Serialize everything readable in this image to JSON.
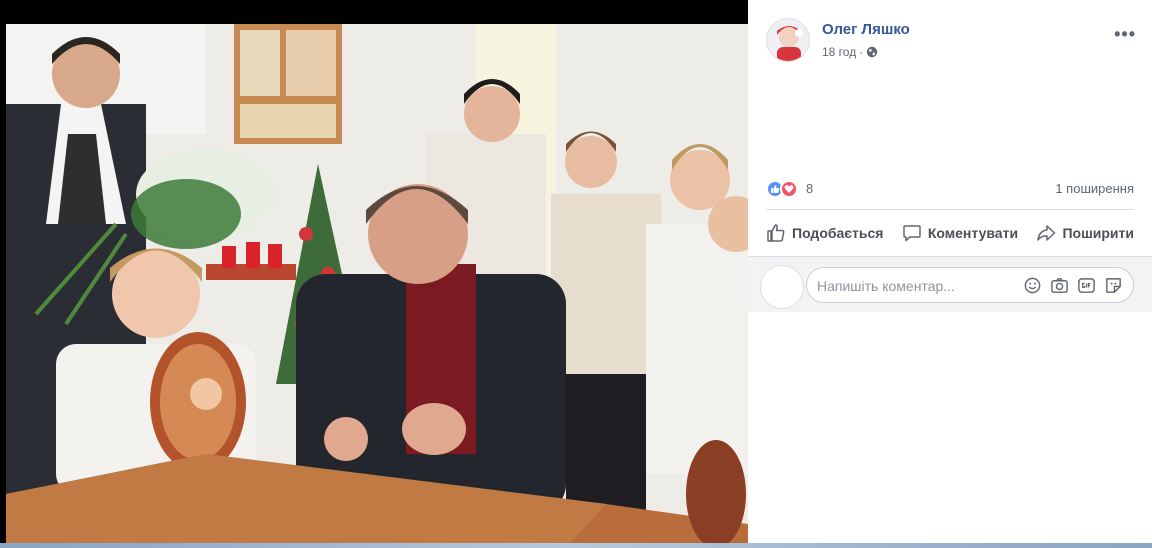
{
  "post": {
    "author": "Олег Ляшко",
    "time": "18 год",
    "privacy_icon": "globe-icon",
    "more_label": "•••"
  },
  "reactions": {
    "icons": [
      "like-icon",
      "love-icon"
    ],
    "count": "8",
    "shares": "1 поширення",
    "colors": {
      "like": "#5890ff",
      "love": "#f25268"
    }
  },
  "actions": {
    "like": "Подобається",
    "comment": "Коментувати",
    "share": "Поширити"
  },
  "comment": {
    "placeholder": "Напишіть коментар...",
    "tools": [
      "emoji-icon",
      "camera-icon",
      "gif-icon",
      "sticker-icon"
    ]
  },
  "theme": {
    "link_blue": "#365899",
    "text_gray": "#616770",
    "action_gray": "#4b4f56"
  }
}
